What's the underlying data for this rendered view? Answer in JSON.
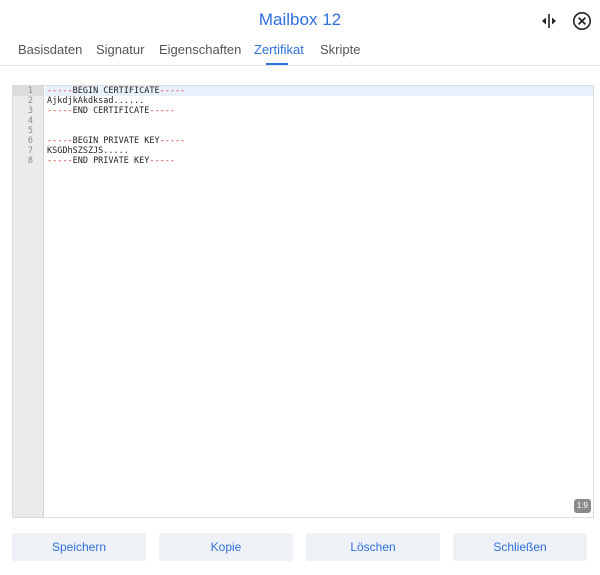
{
  "window": {
    "title": "Mailbox 12"
  },
  "icons": {
    "expand": "split-expand-icon",
    "close": "circle-close-icon",
    "accent": "#2f6fe0"
  },
  "tabs": [
    {
      "label": "Basisdaten",
      "active": false
    },
    {
      "label": "Signatur",
      "active": false
    },
    {
      "label": "Eigenschaften",
      "active": false
    },
    {
      "label": "Zertifikat",
      "active": true
    },
    {
      "label": "Skripte",
      "active": false
    }
  ],
  "editor": {
    "cursor_position": "1:9",
    "lines": [
      {
        "number": "1",
        "text": "-----BEGIN CERTIFICATE-----"
      },
      {
        "number": "2",
        "text": "AjkdjkAkdksad......"
      },
      {
        "number": "3",
        "text": "-----END CERTIFICATE-----"
      },
      {
        "number": "4",
        "text": ""
      },
      {
        "number": "5",
        "text": ""
      },
      {
        "number": "6",
        "text": "-----BEGIN PRIVATE KEY-----"
      },
      {
        "number": "7",
        "text": "KSGDhSZSZJS....."
      },
      {
        "number": "8",
        "text": "-----END PRIVATE KEY-----"
      }
    ]
  },
  "footer": {
    "save_label": "Speichern",
    "copy_label": "Kopie",
    "delete_label": "Löschen",
    "close_label": "Schließen"
  }
}
